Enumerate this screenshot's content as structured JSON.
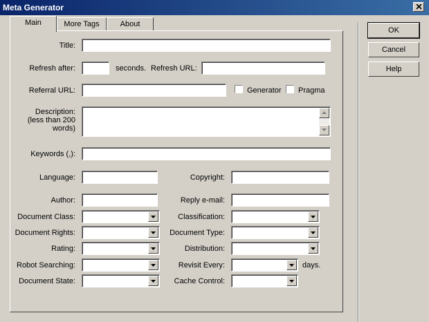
{
  "window": {
    "title": "Meta Generator"
  },
  "tabs": [
    {
      "label": "Main",
      "active": true
    },
    {
      "label": "More Tags",
      "active": false
    },
    {
      "label": "About",
      "active": false
    }
  ],
  "buttons": {
    "ok": "OK",
    "cancel": "Cancel",
    "help": "Help"
  },
  "form": {
    "title_label": "Title:",
    "refresh_after_label": "Refresh after:",
    "seconds_label": "seconds.",
    "refresh_url_label": "Refresh URL:",
    "referral_url_label": "Referral URL:",
    "generator_label": "Generator",
    "pragma_label": "Pragma",
    "description_label_1": "Description:",
    "description_label_2": "(less than 200",
    "description_label_3": "words)",
    "keywords_label": "Keywords (,):",
    "language_label": "Language:",
    "copyright_label": "Copyright:",
    "author_label": "Author:",
    "reply_email_label": "Reply e-mail:",
    "document_class_label": "Document Class:",
    "classification_label": "Classification:",
    "document_rights_label": "Document Rights:",
    "document_type_label": "Document Type:",
    "rating_label": "Rating:",
    "distribution_label": "Distribution:",
    "robot_searching_label": "Robot Searching:",
    "revisit_every_label": "Revisit Every:",
    "days_label": "days.",
    "document_state_label": "Document State:",
    "cache_control_label": "Cache Control:"
  }
}
